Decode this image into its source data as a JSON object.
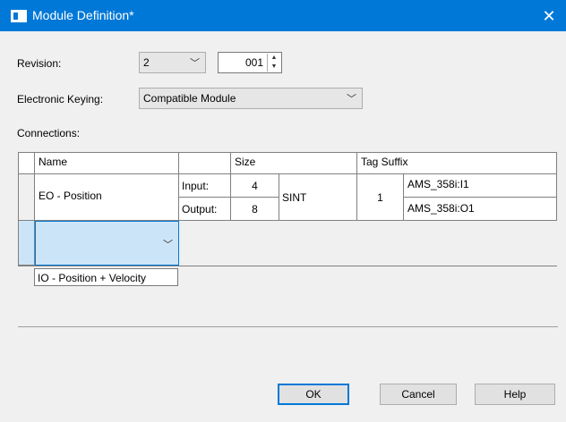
{
  "window": {
    "title": "Module Definition*"
  },
  "revision": {
    "label": "Revision:",
    "major": "2",
    "minor": "001"
  },
  "keying": {
    "label": "Electronic Keying:",
    "value": "Compatible Module"
  },
  "connections": {
    "label": "Connections:",
    "headers": {
      "name": "Name",
      "size": "Size",
      "tag_suffix": "Tag Suffix"
    },
    "row": {
      "name": "EO - Position",
      "input_label": "Input:",
      "output_label": "Output:",
      "input_size": "4",
      "output_size": "8",
      "type": "SINT",
      "tag_count": "1",
      "input_tag": "AMS_358i:I1",
      "output_tag": "AMS_358i:O1"
    },
    "new_row": {
      "value": ""
    },
    "dropdown_option": "IO - Position + Velocity"
  },
  "buttons": {
    "ok": "OK",
    "cancel": "Cancel",
    "help": "Help"
  },
  "colors": {
    "titlebar": "#0078d7",
    "selection": "#cce4f7"
  }
}
